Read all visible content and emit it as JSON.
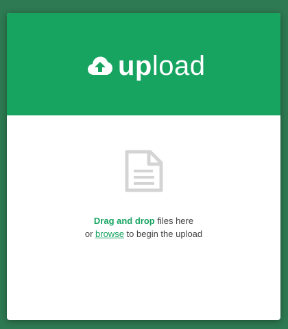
{
  "header": {
    "brand_bold": "up",
    "brand_light": "load",
    "icon": "cloud-upload-icon"
  },
  "dropzone": {
    "icon": "file-document-icon",
    "line1_strong": "Drag and drop",
    "line1_rest": " files here",
    "line2_prefix": "or ",
    "browse_link": "browse",
    "line2_suffix": " to begin the upload"
  },
  "colors": {
    "accent": "#17a461",
    "background": "#2e7a52",
    "icon_gray": "#d4d4d4",
    "text": "#444444"
  }
}
